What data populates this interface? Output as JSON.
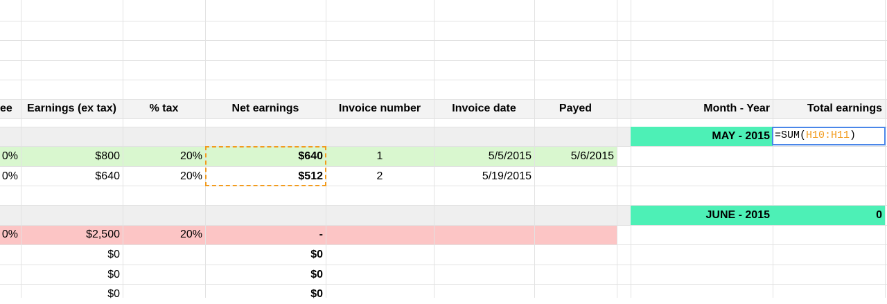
{
  "header": {
    "fee": "ee",
    "earnings": "Earnings (ex tax)",
    "tax": "% tax",
    "net": "Net earnings",
    "invoice_number": "Invoice number",
    "invoice_date": "Invoice date",
    "payed": "Payed",
    "month_year": "Month - Year",
    "total": "Total earnings"
  },
  "rows": [
    {
      "fee": "0%",
      "earnings": "$800",
      "tax": "20%",
      "net": "$640",
      "invoice_number": "1",
      "invoice_date": "5/5/2015",
      "payed": "5/6/2015"
    },
    {
      "fee": "0%",
      "earnings": "$640",
      "tax": "20%",
      "net": "$512",
      "invoice_number": "2",
      "invoice_date": "5/19/2015",
      "payed": ""
    },
    {
      "fee": "0%",
      "earnings": "$2,500",
      "tax": "20%",
      "net": "-"
    },
    {
      "earnings": "$0",
      "net": "$0"
    },
    {
      "earnings": "$0",
      "net": "$0"
    },
    {
      "earnings": "$0",
      "net": "$0"
    }
  ],
  "summary": {
    "may_label": "MAY - 2015",
    "june_label": "JUNE - 2015",
    "june_total": "0"
  },
  "formula": {
    "prefix": "=SUM(",
    "range": "H10:H11",
    "suffix": ")"
  },
  "colors": {
    "header_bg": "#f3f3f3",
    "section_bg": "#efefef",
    "paid_row": "#d9f7cf",
    "unpaid_row": "#fcc5c5",
    "month_bg": "#4df0b6",
    "selection": "#f29b1d",
    "editor_border": "#4a86e8"
  }
}
